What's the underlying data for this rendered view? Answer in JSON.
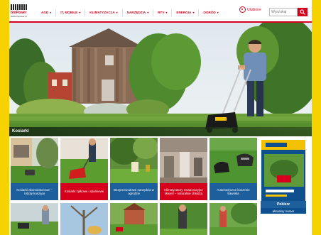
{
  "brand": {
    "name": "bmPower",
    "sub": "www.bmpower.pl"
  },
  "nav": [
    {
      "label": "AGD"
    },
    {
      "label": "IT, MOBILE"
    },
    {
      "label": "KLIMATYZACJA"
    },
    {
      "label": "NARZĘDZIA"
    },
    {
      "label": "RTV"
    },
    {
      "label": "ENERGIA"
    },
    {
      "label": "OGRÓD"
    }
  ],
  "favorites": {
    "label": "Ulubione"
  },
  "search": {
    "placeholder": "Wyszukaj"
  },
  "section": {
    "title": "Kosiarki"
  },
  "tiles": [
    {
      "caption": "Kosiarki akumulatorowe – roboty koszące",
      "color": "blue"
    },
    {
      "caption": "Kosiarki żyłkowe i spalinowe",
      "color": "red"
    },
    {
      "caption": "Bezprzewodowe narzędzia w ogrodzie",
      "color": "blue"
    },
    {
      "caption": "Klimatyzatory ewaporacyjne Maxell – naturalnie chłodzą",
      "color": "red"
    },
    {
      "caption": "Automatyczne koszenie trawnika",
      "color": "blue"
    }
  ],
  "magazine": {
    "download_label": "Pobierz",
    "issue_label": "aktualny numer"
  },
  "colors": {
    "accent": "#d6001c",
    "tile_blue": "#1d5f9c",
    "frame_yellow": "#f6d200"
  }
}
